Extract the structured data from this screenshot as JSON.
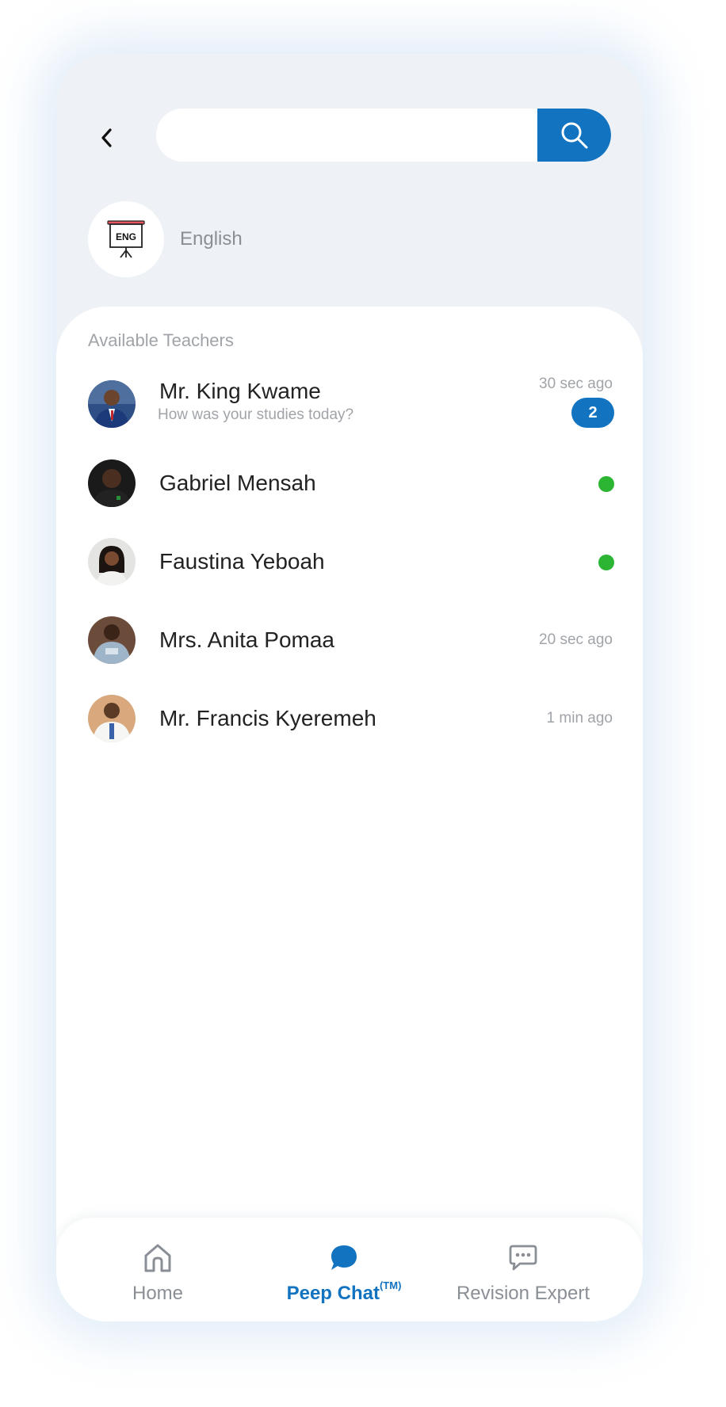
{
  "header": {
    "search_placeholder": "",
    "search_value": ""
  },
  "subject": {
    "icon_text": "ENG",
    "label": "English"
  },
  "teachers_section": {
    "title": "Available Teachers",
    "items": [
      {
        "name": "Mr. King Kwame",
        "message": "How was your studies today?",
        "time": "30 sec ago",
        "unread": "2",
        "online": false
      },
      {
        "name": "Gabriel Mensah",
        "message": "",
        "time": "",
        "unread": "",
        "online": true
      },
      {
        "name": "Faustina Yeboah",
        "message": "",
        "time": "",
        "unread": "",
        "online": true
      },
      {
        "name": "Mrs. Anita Pomaa",
        "message": "",
        "time": "20 sec ago",
        "unread": "",
        "online": false
      },
      {
        "name": "Mr. Francis Kyeremeh",
        "message": "",
        "time": "1 min ago",
        "unread": "",
        "online": false
      }
    ]
  },
  "bottom_nav": {
    "items": [
      {
        "label": "Home",
        "icon": "home-icon",
        "active": false
      },
      {
        "label": "Peep Chat",
        "superscript": "(TM)",
        "icon": "chat-bubble-icon",
        "active": true
      },
      {
        "label": "Revision Expert",
        "icon": "message-dots-icon",
        "active": false
      }
    ]
  },
  "colors": {
    "accent": "#1273c0",
    "online": "#2bb533",
    "background": "#eef2f6"
  }
}
